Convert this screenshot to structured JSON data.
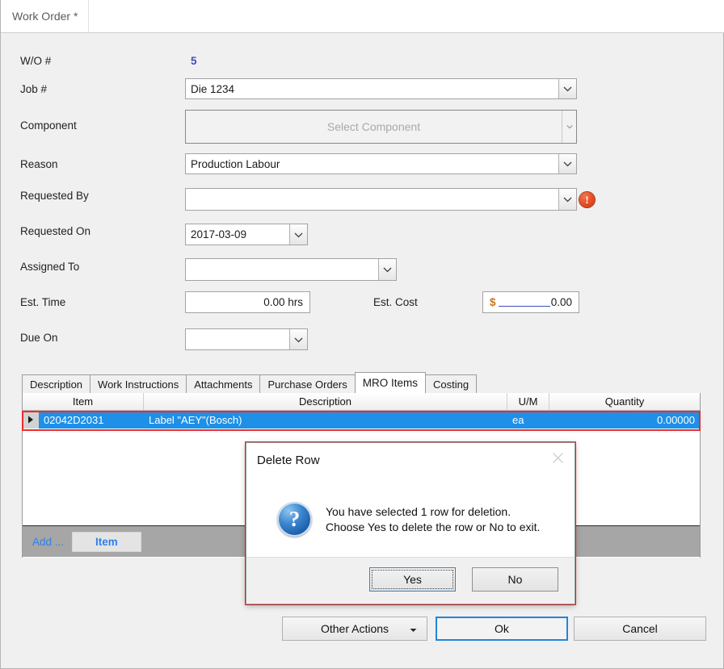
{
  "window": {
    "title": "Work Order *"
  },
  "form": {
    "wo_number": {
      "label": "W/O #",
      "value": "5"
    },
    "job_number": {
      "label": "Job #",
      "value": "Die 1234"
    },
    "component": {
      "label": "Component",
      "placeholder": "Select Component",
      "value": ""
    },
    "reason": {
      "label": "Reason",
      "value": "Production Labour"
    },
    "requested_by": {
      "label": "Requested By",
      "value": "",
      "error": true,
      "error_icon": "error-exclamation-icon"
    },
    "requested_on": {
      "label": "Requested On",
      "value": "2017-03-09"
    },
    "assigned_to": {
      "label": "Assigned To",
      "value": ""
    },
    "est_time": {
      "label": "Est. Time",
      "value": "0.00 hrs"
    },
    "est_cost": {
      "label": "Est. Cost",
      "currency": "$",
      "amount": "0.00"
    },
    "due_on": {
      "label": "Due On",
      "value": ""
    }
  },
  "tabs": [
    {
      "label": "Description",
      "active": false
    },
    {
      "label": "Work Instructions",
      "active": false
    },
    {
      "label": "Attachments",
      "active": false
    },
    {
      "label": "Purchase Orders",
      "active": false
    },
    {
      "label": "MRO Items",
      "active": true
    },
    {
      "label": "Costing",
      "active": false
    }
  ],
  "grid": {
    "columns": [
      "Item",
      "Description",
      "U/M",
      "Quantity"
    ],
    "rows": [
      {
        "item": "02042D2031",
        "description": "Label \"AEY\"(Bosch)",
        "um": "ea",
        "quantity": "0.00000",
        "selected": true
      }
    ],
    "toolbar": {
      "add_label": "Add ...",
      "item_button": "Item"
    }
  },
  "dialog": {
    "title": "Delete Row",
    "close_icon": "close-icon",
    "icon": "question-icon",
    "message_line1": "You have selected 1 row for deletion.",
    "message_line2": "Choose Yes to delete the row or No to exit.",
    "yes_label": "Yes",
    "no_label": "No"
  },
  "footer": {
    "other_actions": "Other Actions",
    "ok": "Ok",
    "cancel": "Cancel"
  },
  "colors": {
    "selection_blue": "#1e90e8",
    "annotation_red": "#ec2c2c",
    "focus_blue": "#1f86d8",
    "link_blue": "#2f80ed",
    "value_blue": "#3f4fb5",
    "error_orange": "#e8542a"
  }
}
